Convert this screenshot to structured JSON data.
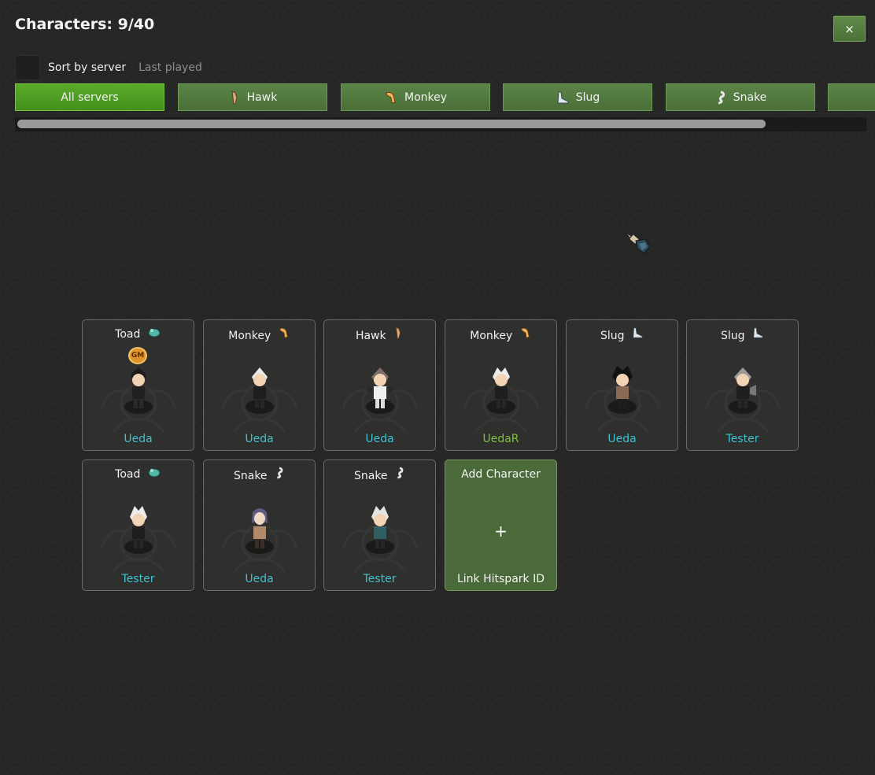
{
  "header": {
    "title": "Characters: 9/40",
    "close_label": "×"
  },
  "sort": {
    "label": "Sort by server",
    "option": "Last played"
  },
  "tabs": [
    {
      "label": "All servers",
      "icon": "",
      "active": true
    },
    {
      "label": "Hawk",
      "icon": "hawk-icon"
    },
    {
      "label": "Monkey",
      "icon": "monkey-icon"
    },
    {
      "label": "Slug",
      "icon": "slug-icon"
    },
    {
      "label": "Snake",
      "icon": "snake-icon"
    }
  ],
  "characters": [
    {
      "server": "Toad",
      "icon": "toad-icon",
      "name": "Ueda",
      "gm": true
    },
    {
      "server": "Monkey",
      "icon": "monkey-icon",
      "name": "Ueda"
    },
    {
      "server": "Hawk",
      "icon": "hawk-icon",
      "name": "Ueda"
    },
    {
      "server": "Monkey",
      "icon": "monkey-icon",
      "name": "UedaR"
    },
    {
      "server": "Slug",
      "icon": "slug-icon",
      "name": "Ueda"
    },
    {
      "server": "Slug",
      "icon": "slug-icon",
      "name": "Tester"
    },
    {
      "server": "Toad",
      "icon": "toad-icon",
      "name": "Tester"
    },
    {
      "server": "Snake",
      "icon": "snake-icon",
      "name": "Ueda"
    },
    {
      "server": "Snake",
      "icon": "snake-icon",
      "name": "Tester"
    }
  ],
  "add_card": {
    "title": "Add Character",
    "plus": "+",
    "link": "Link Hitspark ID"
  },
  "gm_badge": "GM",
  "colors": {
    "accent_green": "#4a6f38",
    "active_tab": "#43901c",
    "name_cyan": "#3fc0d0",
    "name_green": "#7ec23a"
  }
}
